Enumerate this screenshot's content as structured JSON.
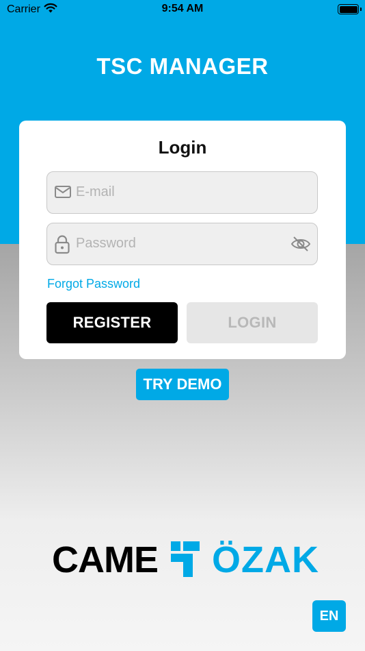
{
  "status_bar": {
    "carrier": "Carrier",
    "time": "9:54 AM"
  },
  "app": {
    "title": "TSC MANAGER"
  },
  "login_card": {
    "title": "Login",
    "email": {
      "placeholder": "E-mail",
      "value": "",
      "icon": "mail-icon"
    },
    "password": {
      "placeholder": "Password",
      "value": "",
      "icon": "lock-icon",
      "toggle_icon": "eye-off-icon"
    },
    "forgot_label": "Forgot Password",
    "register_label": "REGISTER",
    "login_label": "LOGIN"
  },
  "demo_label": "TRY DEMO",
  "brand": {
    "left": "CAME",
    "right": "ÖZAK"
  },
  "language": "EN",
  "colors": {
    "accent": "#00a9e6",
    "register_bg": "#000000",
    "login_disabled_bg": "#e6e6e6"
  }
}
